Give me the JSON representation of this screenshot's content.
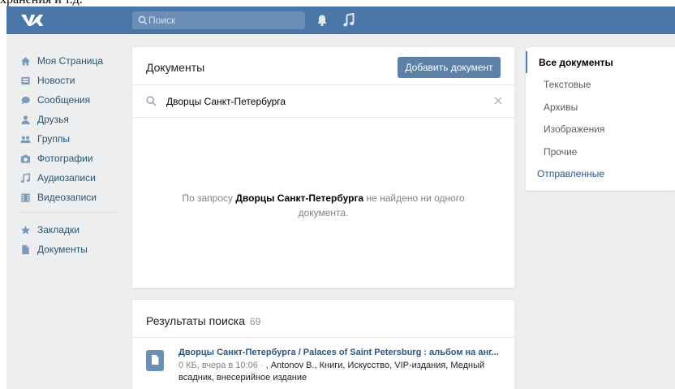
{
  "top_strip_text": "хранения и т.д.",
  "header": {
    "search_placeholder": "Поиск",
    "logo_icon": "vk-logo-icon",
    "notifications_icon": "bell-icon",
    "music_icon": "music-note-icon"
  },
  "sidebar": {
    "items": [
      {
        "label": "Моя Страница",
        "icon": "home-icon"
      },
      {
        "label": "Новости",
        "icon": "news-icon"
      },
      {
        "label": "Сообщения",
        "icon": "messages-icon"
      },
      {
        "label": "Друзья",
        "icon": "friend-icon"
      },
      {
        "label": "Группы",
        "icon": "groups-icon"
      },
      {
        "label": "Фотографии",
        "icon": "camera-icon"
      },
      {
        "label": "Аудиозаписи",
        "icon": "music-icon"
      },
      {
        "label": "Видеозаписи",
        "icon": "video-icon"
      }
    ],
    "bottom_items": [
      {
        "label": "Закладки",
        "icon": "star-icon"
      },
      {
        "label": "Документы",
        "icon": "document-icon"
      }
    ]
  },
  "documents": {
    "title": "Документы",
    "add_button": "Добавить документ",
    "query": "Дворцы Санкт-Петербурга",
    "empty_prefix": "По запросу",
    "empty_query": "Дворцы Санкт-Петербурга",
    "empty_suffix": "не найдено ни одного документа."
  },
  "results": {
    "title": "Результаты поиска",
    "count": "69",
    "items": [
      {
        "name": "Дворцы Санкт-Петербурга / Palaces of Saint Petersburg : альбом на анг...",
        "meta_prefix": "0 КБ, вчера в 10:06 · ",
        "meta_tags": ", Antonov B., Книги, Искусство, VIP-издания, Медный всадник, внесерийное издание"
      }
    ]
  },
  "filters": {
    "items": [
      {
        "label": "Все документы"
      },
      {
        "label": "Текстовые"
      },
      {
        "label": "Архивы"
      },
      {
        "label": "Изображения"
      },
      {
        "label": "Прочие"
      },
      {
        "label": "Отправленные"
      }
    ]
  },
  "colors": {
    "header_bg": "#4a76a8",
    "page_bg": "#edeef0",
    "link": "#2a5885",
    "button_bg": "#5e81a8",
    "active_filter_bar": "#5181b8"
  }
}
